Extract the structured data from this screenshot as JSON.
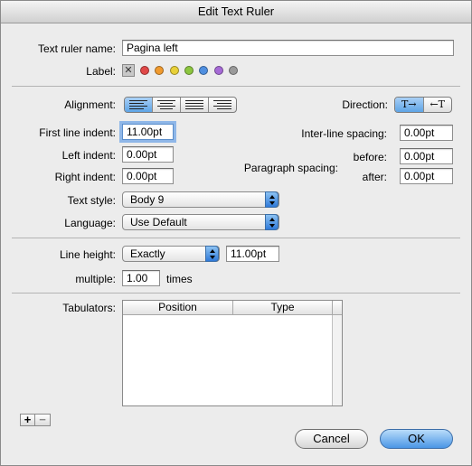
{
  "window": {
    "title": "Edit Text Ruler"
  },
  "ruler_name": {
    "label": "Text ruler name:",
    "value": "Pagina left"
  },
  "color_label": {
    "label": "Label:",
    "none_symbol": "✕",
    "colors": [
      "#e04848",
      "#f09a2e",
      "#e8d038",
      "#8cc63f",
      "#4f8fe0",
      "#a66ad6",
      "#9a9a9a"
    ]
  },
  "alignment": {
    "label": "Alignment:",
    "options": [
      "left",
      "center",
      "justify",
      "right"
    ],
    "selected": "left"
  },
  "direction": {
    "label": "Direction:",
    "options": [
      "T→",
      "←T"
    ],
    "selected": "T→"
  },
  "indents": {
    "first_line_label": "First line indent:",
    "first_line_value": "11.00pt",
    "left_label": "Left indent:",
    "left_value": "0.00pt",
    "right_label": "Right indent:",
    "right_value": "0.00pt"
  },
  "spacing": {
    "inter_line_label": "Inter-line spacing:",
    "inter_line_value": "0.00pt",
    "paragraph_label": "Paragraph spacing:",
    "before_label": "before:",
    "before_value": "0.00pt",
    "after_label": "after:",
    "after_value": "0.00pt"
  },
  "text_style": {
    "label": "Text style:",
    "value": "Body 9"
  },
  "language": {
    "label": "Language:",
    "value": "Use Default"
  },
  "line_height": {
    "label": "Line height:",
    "mode": "Exactly",
    "value": "11.00pt",
    "multiple_label": "multiple:",
    "multiple_value": "1.00",
    "times_label": "times"
  },
  "tabulators": {
    "label": "Tabulators:",
    "columns": [
      "Position",
      "Type"
    ],
    "rows": []
  },
  "tab_controls": {
    "add": "+",
    "remove": "−"
  },
  "buttons": {
    "cancel": "Cancel",
    "ok": "OK"
  }
}
